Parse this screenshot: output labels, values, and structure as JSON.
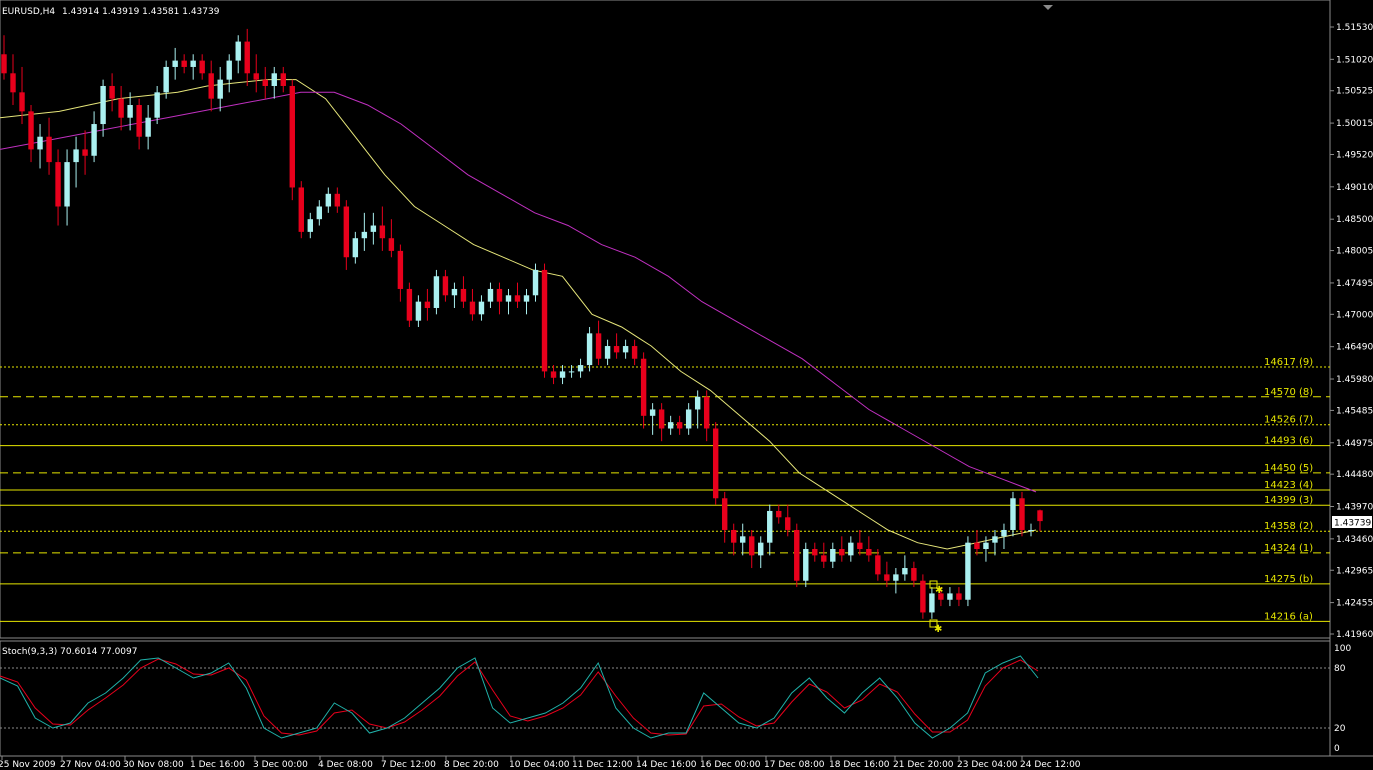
{
  "header": {
    "symbol": "EURUSD,H4",
    "ohlc": "1.43914 1.43919 1.43581 1.43739"
  },
  "price_axis": {
    "ticks": [
      "1.51530",
      "1.51020",
      "1.50525",
      "1.50015",
      "1.49520",
      "1.49010",
      "1.48500",
      "1.48005",
      "1.47495",
      "1.47000",
      "1.46490",
      "1.45980",
      "1.45485",
      "1.44975",
      "1.44480",
      "1.43970",
      "1.43460",
      "1.42965",
      "1.42455",
      "1.41960"
    ],
    "current_price": "1.43739"
  },
  "levels": [
    {
      "label": "14617 (9)",
      "price": 1.4617,
      "style": "dotted"
    },
    {
      "label": "14570 (8)",
      "price": 1.457,
      "style": "dashed"
    },
    {
      "label": "14526 (7)",
      "price": 1.4526,
      "style": "dotted"
    },
    {
      "label": "14493 (6)",
      "price": 1.4493,
      "style": "solid"
    },
    {
      "label": "14450 (5)",
      "price": 1.445,
      "style": "dashed"
    },
    {
      "label": "14423 (4)",
      "price": 1.4423,
      "style": "solid"
    },
    {
      "label": "14399 (3)",
      "price": 1.4399,
      "style": "solid"
    },
    {
      "label": "14358 (2)",
      "price": 1.4358,
      "style": "dotted"
    },
    {
      "label": "14324 (1)",
      "price": 1.4324,
      "style": "dashed"
    },
    {
      "label": "14275 (b)",
      "price": 1.4275,
      "style": "solid"
    },
    {
      "label": "14216 (a)",
      "price": 1.4216,
      "style": "solid"
    }
  ],
  "stoch": {
    "label": "Stoch(9,3,3) 70.6014 77.0097",
    "ticks": [
      "100",
      "80",
      "20",
      "0"
    ]
  },
  "time_axis": [
    "25 Nov 2009",
    "27 Nov 04:00",
    "30 Nov 08:00",
    "1 Dec 16:00",
    "3 Dec 00:00",
    "4 Dec 08:00",
    "7 Dec 12:00",
    "8 Dec 20:00",
    "10 Dec 04:00",
    "11 Dec 12:00",
    "14 Dec 16:00",
    "16 Dec 00:00",
    "17 Dec 08:00",
    "18 Dec 16:00",
    "21 Dec 20:00",
    "23 Dec 04:00",
    "24 Dec 12:00"
  ],
  "colors": {
    "bull": "#aaf0f0",
    "bear": "#e8001c",
    "ma_fast": "#e6e67a",
    "ma_slow": "#c030c0",
    "level": "#e6e600",
    "stoch_main": "#20b2aa",
    "stoch_signal": "#e8001c"
  },
  "chart_data": {
    "type": "candlestick",
    "symbol": "EURUSD",
    "timeframe": "H4",
    "ylim": [
      1.418,
      1.518
    ],
    "ohlc": [
      {
        "o": 1.511,
        "h": 1.514,
        "l": 1.507,
        "c": 1.508
      },
      {
        "o": 1.508,
        "h": 1.511,
        "l": 1.503,
        "c": 1.505
      },
      {
        "o": 1.505,
        "h": 1.509,
        "l": 1.5,
        "c": 1.502
      },
      {
        "o": 1.502,
        "h": 1.503,
        "l": 1.494,
        "c": 1.496
      },
      {
        "o": 1.496,
        "h": 1.5,
        "l": 1.493,
        "c": 1.498
      },
      {
        "o": 1.498,
        "h": 1.501,
        "l": 1.492,
        "c": 1.494
      },
      {
        "o": 1.494,
        "h": 1.496,
        "l": 1.484,
        "c": 1.487
      },
      {
        "o": 1.487,
        "h": 1.496,
        "l": 1.484,
        "c": 1.494
      },
      {
        "o": 1.494,
        "h": 1.498,
        "l": 1.49,
        "c": 1.496
      },
      {
        "o": 1.496,
        "h": 1.499,
        "l": 1.492,
        "c": 1.495
      },
      {
        "o": 1.495,
        "h": 1.502,
        "l": 1.494,
        "c": 1.5
      },
      {
        "o": 1.5,
        "h": 1.507,
        "l": 1.498,
        "c": 1.506
      },
      {
        "o": 1.506,
        "h": 1.508,
        "l": 1.502,
        "c": 1.504
      },
      {
        "o": 1.504,
        "h": 1.506,
        "l": 1.499,
        "c": 1.501
      },
      {
        "o": 1.501,
        "h": 1.505,
        "l": 1.499,
        "c": 1.503
      },
      {
        "o": 1.503,
        "h": 1.504,
        "l": 1.496,
        "c": 1.498
      },
      {
        "o": 1.498,
        "h": 1.503,
        "l": 1.496,
        "c": 1.501
      },
      {
        "o": 1.501,
        "h": 1.506,
        "l": 1.5,
        "c": 1.505
      },
      {
        "o": 1.505,
        "h": 1.51,
        "l": 1.504,
        "c": 1.509
      },
      {
        "o": 1.509,
        "h": 1.512,
        "l": 1.507,
        "c": 1.51
      },
      {
        "o": 1.51,
        "h": 1.511,
        "l": 1.508,
        "c": 1.509
      },
      {
        "o": 1.509,
        "h": 1.511,
        "l": 1.507,
        "c": 1.51
      },
      {
        "o": 1.51,
        "h": 1.511,
        "l": 1.507,
        "c": 1.508
      },
      {
        "o": 1.508,
        "h": 1.51,
        "l": 1.502,
        "c": 1.504
      },
      {
        "o": 1.504,
        "h": 1.509,
        "l": 1.502,
        "c": 1.507
      },
      {
        "o": 1.507,
        "h": 1.511,
        "l": 1.505,
        "c": 1.51
      },
      {
        "o": 1.51,
        "h": 1.514,
        "l": 1.508,
        "c": 1.513
      },
      {
        "o": 1.513,
        "h": 1.515,
        "l": 1.506,
        "c": 1.508
      },
      {
        "o": 1.508,
        "h": 1.511,
        "l": 1.505,
        "c": 1.507
      },
      {
        "o": 1.507,
        "h": 1.509,
        "l": 1.504,
        "c": 1.506
      },
      {
        "o": 1.506,
        "h": 1.509,
        "l": 1.504,
        "c": 1.508
      },
      {
        "o": 1.508,
        "h": 1.509,
        "l": 1.505,
        "c": 1.506
      },
      {
        "o": 1.506,
        "h": 1.507,
        "l": 1.488,
        "c": 1.49
      },
      {
        "o": 1.49,
        "h": 1.491,
        "l": 1.482,
        "c": 1.483
      },
      {
        "o": 1.483,
        "h": 1.486,
        "l": 1.482,
        "c": 1.485
      },
      {
        "o": 1.485,
        "h": 1.488,
        "l": 1.484,
        "c": 1.487
      },
      {
        "o": 1.487,
        "h": 1.49,
        "l": 1.486,
        "c": 1.489
      },
      {
        "o": 1.489,
        "h": 1.49,
        "l": 1.486,
        "c": 1.487
      },
      {
        "o": 1.487,
        "h": 1.488,
        "l": 1.477,
        "c": 1.479
      },
      {
        "o": 1.479,
        "h": 1.483,
        "l": 1.478,
        "c": 1.482
      },
      {
        "o": 1.482,
        "h": 1.486,
        "l": 1.48,
        "c": 1.483
      },
      {
        "o": 1.483,
        "h": 1.486,
        "l": 1.481,
        "c": 1.484
      },
      {
        "o": 1.484,
        "h": 1.487,
        "l": 1.48,
        "c": 1.482
      },
      {
        "o": 1.482,
        "h": 1.485,
        "l": 1.479,
        "c": 1.48
      },
      {
        "o": 1.48,
        "h": 1.481,
        "l": 1.472,
        "c": 1.474
      },
      {
        "o": 1.474,
        "h": 1.475,
        "l": 1.468,
        "c": 1.469
      },
      {
        "o": 1.469,
        "h": 1.473,
        "l": 1.468,
        "c": 1.472
      },
      {
        "o": 1.472,
        "h": 1.474,
        "l": 1.469,
        "c": 1.471
      },
      {
        "o": 1.471,
        "h": 1.477,
        "l": 1.47,
        "c": 1.476
      },
      {
        "o": 1.476,
        "h": 1.477,
        "l": 1.472,
        "c": 1.473
      },
      {
        "o": 1.473,
        "h": 1.475,
        "l": 1.471,
        "c": 1.474
      },
      {
        "o": 1.474,
        "h": 1.476,
        "l": 1.471,
        "c": 1.472
      },
      {
        "o": 1.472,
        "h": 1.474,
        "l": 1.469,
        "c": 1.47
      },
      {
        "o": 1.47,
        "h": 1.473,
        "l": 1.469,
        "c": 1.472
      },
      {
        "o": 1.472,
        "h": 1.475,
        "l": 1.471,
        "c": 1.474
      },
      {
        "o": 1.474,
        "h": 1.475,
        "l": 1.47,
        "c": 1.472
      },
      {
        "o": 1.472,
        "h": 1.474,
        "l": 1.47,
        "c": 1.473
      },
      {
        "o": 1.473,
        "h": 1.475,
        "l": 1.471,
        "c": 1.472
      },
      {
        "o": 1.472,
        "h": 1.474,
        "l": 1.47,
        "c": 1.473
      },
      {
        "o": 1.473,
        "h": 1.478,
        "l": 1.472,
        "c": 1.477
      },
      {
        "o": 1.477,
        "h": 1.478,
        "l": 1.46,
        "c": 1.461
      },
      {
        "o": 1.461,
        "h": 1.462,
        "l": 1.459,
        "c": 1.46
      },
      {
        "o": 1.46,
        "h": 1.462,
        "l": 1.459,
        "c": 1.461
      },
      {
        "o": 1.461,
        "h": 1.462,
        "l": 1.46,
        "c": 1.461
      },
      {
        "o": 1.461,
        "h": 1.463,
        "l": 1.46,
        "c": 1.462
      },
      {
        "o": 1.462,
        "h": 1.468,
        "l": 1.461,
        "c": 1.467
      },
      {
        "o": 1.467,
        "h": 1.469,
        "l": 1.462,
        "c": 1.463
      },
      {
        "o": 1.463,
        "h": 1.466,
        "l": 1.462,
        "c": 1.465
      },
      {
        "o": 1.465,
        "h": 1.467,
        "l": 1.463,
        "c": 1.464
      },
      {
        "o": 1.464,
        "h": 1.466,
        "l": 1.463,
        "c": 1.465
      },
      {
        "o": 1.465,
        "h": 1.466,
        "l": 1.462,
        "c": 1.463
      },
      {
        "o": 1.463,
        "h": 1.464,
        "l": 1.452,
        "c": 1.454
      },
      {
        "o": 1.454,
        "h": 1.456,
        "l": 1.451,
        "c": 1.455
      },
      {
        "o": 1.455,
        "h": 1.456,
        "l": 1.45,
        "c": 1.452
      },
      {
        "o": 1.452,
        "h": 1.454,
        "l": 1.451,
        "c": 1.453
      },
      {
        "o": 1.453,
        "h": 1.454,
        "l": 1.451,
        "c": 1.452
      },
      {
        "o": 1.452,
        "h": 1.456,
        "l": 1.451,
        "c": 1.455
      },
      {
        "o": 1.455,
        "h": 1.458,
        "l": 1.452,
        "c": 1.457
      },
      {
        "o": 1.457,
        "h": 1.458,
        "l": 1.45,
        "c": 1.452
      },
      {
        "o": 1.452,
        "h": 1.453,
        "l": 1.44,
        "c": 1.441
      },
      {
        "o": 1.441,
        "h": 1.442,
        "l": 1.434,
        "c": 1.436
      },
      {
        "o": 1.436,
        "h": 1.437,
        "l": 1.432,
        "c": 1.434
      },
      {
        "o": 1.434,
        "h": 1.437,
        "l": 1.432,
        "c": 1.435
      },
      {
        "o": 1.435,
        "h": 1.436,
        "l": 1.43,
        "c": 1.432
      },
      {
        "o": 1.432,
        "h": 1.435,
        "l": 1.43,
        "c": 1.434
      },
      {
        "o": 1.434,
        "h": 1.44,
        "l": 1.432,
        "c": 1.439
      },
      {
        "o": 1.439,
        "h": 1.44,
        "l": 1.437,
        "c": 1.438
      },
      {
        "o": 1.438,
        "h": 1.44,
        "l": 1.435,
        "c": 1.436
      },
      {
        "o": 1.436,
        "h": 1.437,
        "l": 1.427,
        "c": 1.428
      },
      {
        "o": 1.428,
        "h": 1.434,
        "l": 1.427,
        "c": 1.433
      },
      {
        "o": 1.433,
        "h": 1.434,
        "l": 1.431,
        "c": 1.432
      },
      {
        "o": 1.432,
        "h": 1.434,
        "l": 1.43,
        "c": 1.431
      },
      {
        "o": 1.431,
        "h": 1.434,
        "l": 1.43,
        "c": 1.433
      },
      {
        "o": 1.433,
        "h": 1.435,
        "l": 1.431,
        "c": 1.432
      },
      {
        "o": 1.432,
        "h": 1.435,
        "l": 1.431,
        "c": 1.434
      },
      {
        "o": 1.434,
        "h": 1.436,
        "l": 1.432,
        "c": 1.433
      },
      {
        "o": 1.433,
        "h": 1.435,
        "l": 1.431,
        "c": 1.432
      },
      {
        "o": 1.432,
        "h": 1.433,
        "l": 1.428,
        "c": 1.429
      },
      {
        "o": 1.429,
        "h": 1.431,
        "l": 1.427,
        "c": 1.428
      },
      {
        "o": 1.428,
        "h": 1.43,
        "l": 1.426,
        "c": 1.429
      },
      {
        "o": 1.429,
        "h": 1.432,
        "l": 1.428,
        "c": 1.43
      },
      {
        "o": 1.43,
        "h": 1.431,
        "l": 1.427,
        "c": 1.428
      },
      {
        "o": 1.428,
        "h": 1.429,
        "l": 1.422,
        "c": 1.423
      },
      {
        "o": 1.423,
        "h": 1.427,
        "l": 1.422,
        "c": 1.426
      },
      {
        "o": 1.426,
        "h": 1.427,
        "l": 1.424,
        "c": 1.425
      },
      {
        "o": 1.425,
        "h": 1.427,
        "l": 1.424,
        "c": 1.426
      },
      {
        "o": 1.426,
        "h": 1.427,
        "l": 1.424,
        "c": 1.425
      },
      {
        "o": 1.425,
        "h": 1.435,
        "l": 1.424,
        "c": 1.434
      },
      {
        "o": 1.434,
        "h": 1.436,
        "l": 1.432,
        "c": 1.433
      },
      {
        "o": 1.433,
        "h": 1.435,
        "l": 1.431,
        "c": 1.434
      },
      {
        "o": 1.434,
        "h": 1.436,
        "l": 1.432,
        "c": 1.435
      },
      {
        "o": 1.435,
        "h": 1.437,
        "l": 1.433,
        "c": 1.436
      },
      {
        "o": 1.436,
        "h": 1.442,
        "l": 1.435,
        "c": 1.441
      },
      {
        "o": 1.441,
        "h": 1.442,
        "l": 1.435,
        "c": 1.436
      },
      {
        "o": 1.436,
        "h": 1.437,
        "l": 1.435,
        "c": 1.436
      },
      {
        "o": 1.4391,
        "h": 1.4392,
        "l": 1.4358,
        "c": 1.4374
      }
    ],
    "ma_fast": [
      1.501,
      1.5015,
      1.502,
      1.503,
      1.504,
      1.5045,
      1.505,
      1.506,
      1.5065,
      1.507,
      1.507,
      1.504,
      1.498,
      1.492,
      1.487,
      1.484,
      1.481,
      1.479,
      1.477,
      1.476,
      1.47,
      1.468,
      1.465,
      1.461,
      1.458,
      1.454,
      1.45,
      1.445,
      1.442,
      1.439,
      1.436,
      1.434,
      1.433,
      1.434,
      1.435,
      1.436
    ],
    "ma_slow": [
      1.496,
      1.497,
      1.498,
      1.499,
      1.5,
      1.501,
      1.502,
      1.503,
      1.504,
      1.505,
      1.505,
      1.503,
      1.5,
      1.496,
      1.492,
      1.489,
      1.486,
      1.484,
      1.481,
      1.479,
      1.476,
      1.472,
      1.469,
      1.466,
      1.463,
      1.459,
      1.455,
      1.452,
      1.449,
      1.446,
      1.444,
      1.442
    ],
    "stoch_main": [
      70,
      62,
      30,
      20,
      25,
      45,
      55,
      70,
      88,
      90,
      80,
      70,
      75,
      85,
      60,
      20,
      10,
      15,
      20,
      45,
      35,
      15,
      20,
      30,
      45,
      60,
      80,
      90,
      40,
      25,
      30,
      35,
      45,
      60,
      85,
      40,
      20,
      10,
      15,
      15,
      55,
      40,
      25,
      20,
      30,
      55,
      70,
      50,
      35,
      55,
      70,
      50,
      25,
      10,
      20,
      35,
      75,
      85,
      92,
      70
    ],
    "stoch_signal": [
      72,
      66,
      40,
      24,
      23,
      38,
      50,
      63,
      80,
      89,
      84,
      74,
      73,
      80,
      68,
      32,
      15,
      13,
      17,
      35,
      38,
      24,
      20,
      26,
      38,
      52,
      72,
      86,
      58,
      32,
      27,
      32,
      40,
      53,
      76,
      52,
      30,
      15,
      13,
      14,
      42,
      44,
      31,
      22,
      25,
      46,
      64,
      56,
      40,
      48,
      64,
      56,
      34,
      16,
      16,
      28,
      62,
      80,
      88,
      77
    ]
  }
}
